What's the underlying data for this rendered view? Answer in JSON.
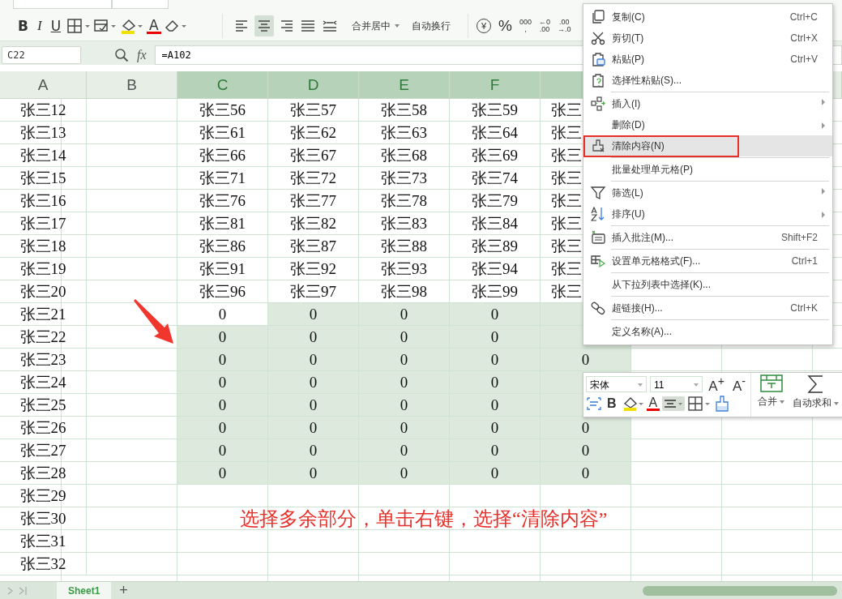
{
  "ribbon": {
    "font_buttons": [
      {
        "kind": "bold",
        "label": "B"
      },
      {
        "kind": "italic",
        "label": "I"
      },
      {
        "kind": "underline",
        "label": "U"
      },
      {
        "kind": "border"
      },
      {
        "kind": "cell-style"
      },
      {
        "kind": "fill"
      },
      {
        "kind": "font-color",
        "label": "A"
      },
      {
        "kind": "eraser"
      }
    ],
    "align_buttons": [
      {
        "kind": "left",
        "selected": false
      },
      {
        "kind": "center",
        "selected": true
      },
      {
        "kind": "right",
        "selected": false
      },
      {
        "kind": "justify",
        "selected": false
      },
      {
        "kind": "distribute",
        "selected": false
      }
    ],
    "merge_label": "合并居中",
    "wrap_label": "自动换行",
    "number_buttons": [
      {
        "kind": "currency",
        "lines": [
          "¥"
        ]
      },
      {
        "kind": "percent",
        "lines": [
          "%"
        ]
      },
      {
        "kind": "thousands",
        "lines": [
          "000",
          ","
        ]
      },
      {
        "kind": "increase-decimal",
        "lines": [
          "←0",
          ".00"
        ]
      },
      {
        "kind": "decrease-decimal",
        "lines": [
          ".00",
          "→.0"
        ]
      }
    ]
  },
  "formula_bar": {
    "name_box": "C22",
    "fx": "fx",
    "formula": "=A102"
  },
  "columns": [
    {
      "label": "A",
      "selected": false
    },
    {
      "label": "B",
      "selected": false
    },
    {
      "label": "C",
      "selected": true
    },
    {
      "label": "D",
      "selected": true
    },
    {
      "label": "E",
      "selected": true
    },
    {
      "label": "F",
      "selected": true
    },
    {
      "selected": true
    }
  ],
  "rows": [
    {
      "label": "张三12",
      "cells": [
        {
          "text": "张三56",
          "selected": false
        },
        {
          "text": "张三57",
          "selected": false
        },
        {
          "text": "张三58",
          "selected": false
        },
        {
          "text": "张三59",
          "selected": false
        },
        {
          "text": "张三",
          "selected": false
        }
      ]
    },
    {
      "label": "张三13",
      "cells": [
        {
          "text": "张三61",
          "selected": false
        },
        {
          "text": "张三62",
          "selected": false
        },
        {
          "text": "张三63",
          "selected": false
        },
        {
          "text": "张三64",
          "selected": false
        },
        {
          "text": "张三",
          "selected": false
        }
      ]
    },
    {
      "label": "张三14",
      "cells": [
        {
          "text": "张三66",
          "selected": false
        },
        {
          "text": "张三67",
          "selected": false
        },
        {
          "text": "张三68",
          "selected": false
        },
        {
          "text": "张三69",
          "selected": false
        },
        {
          "text": "张三",
          "selected": false
        }
      ]
    },
    {
      "label": "张三15",
      "cells": [
        {
          "text": "张三71",
          "selected": false
        },
        {
          "text": "张三72",
          "selected": false
        },
        {
          "text": "张三73",
          "selected": false
        },
        {
          "text": "张三74",
          "selected": false
        },
        {
          "text": "张三",
          "selected": false
        }
      ]
    },
    {
      "label": "张三16",
      "cells": [
        {
          "text": "张三76",
          "selected": false
        },
        {
          "text": "张三77",
          "selected": false
        },
        {
          "text": "张三78",
          "selected": false
        },
        {
          "text": "张三79",
          "selected": false
        },
        {
          "text": "张三",
          "selected": false
        }
      ]
    },
    {
      "label": "张三17",
      "cells": [
        {
          "text": "张三81",
          "selected": false
        },
        {
          "text": "张三82",
          "selected": false
        },
        {
          "text": "张三83",
          "selected": false
        },
        {
          "text": "张三84",
          "selected": false
        },
        {
          "text": "张三",
          "selected": false
        }
      ]
    },
    {
      "label": "张三18",
      "cells": [
        {
          "text": "张三86",
          "selected": false
        },
        {
          "text": "张三87",
          "selected": false
        },
        {
          "text": "张三88",
          "selected": false
        },
        {
          "text": "张三89",
          "selected": false
        },
        {
          "text": "张三",
          "selected": false
        }
      ]
    },
    {
      "label": "张三19",
      "cells": [
        {
          "text": "张三91",
          "selected": false
        },
        {
          "text": "张三92",
          "selected": false
        },
        {
          "text": "张三93",
          "selected": false
        },
        {
          "text": "张三94",
          "selected": false
        },
        {
          "text": "张三",
          "selected": false
        }
      ]
    },
    {
      "label": "张三20",
      "cells": [
        {
          "text": "张三96",
          "selected": false
        },
        {
          "text": "张三97",
          "selected": false
        },
        {
          "text": "张三98",
          "selected": false
        },
        {
          "text": "张三99",
          "selected": false
        },
        {
          "text": "张三",
          "selected": false
        }
      ]
    },
    {
      "label": "张三21",
      "cells": [
        {
          "text": "0",
          "selected": false
        },
        {
          "text": "0",
          "selected": true
        },
        {
          "text": "0",
          "selected": true
        },
        {
          "text": "0",
          "selected": true
        },
        {
          "selected": true
        }
      ]
    },
    {
      "label": "张三22",
      "cells": [
        {
          "text": "0",
          "selected": true
        },
        {
          "text": "0",
          "selected": true
        },
        {
          "text": "0",
          "selected": true
        },
        {
          "text": "0",
          "selected": true
        },
        {
          "selected": true
        }
      ]
    },
    {
      "label": "张三23",
      "cells": [
        {
          "text": "0",
          "selected": true
        },
        {
          "text": "0",
          "selected": true
        },
        {
          "text": "0",
          "selected": true
        },
        {
          "text": "0",
          "selected": true
        },
        {
          "text": "0",
          "selected": true
        }
      ]
    },
    {
      "label": "张三24",
      "cells": [
        {
          "text": "0",
          "selected": true
        },
        {
          "text": "0",
          "selected": true
        },
        {
          "text": "0",
          "selected": true
        },
        {
          "text": "0",
          "selected": true
        },
        {
          "selected": true
        }
      ]
    },
    {
      "label": "张三25",
      "cells": [
        {
          "text": "0",
          "selected": true
        },
        {
          "text": "0",
          "selected": true
        },
        {
          "text": "0",
          "selected": true
        },
        {
          "text": "0",
          "selected": true
        },
        {
          "selected": true
        }
      ]
    },
    {
      "label": "张三26",
      "cells": [
        {
          "text": "0",
          "selected": true
        },
        {
          "text": "0",
          "selected": true
        },
        {
          "text": "0",
          "selected": true
        },
        {
          "text": "0",
          "selected": true
        },
        {
          "text": "0",
          "selected": true
        }
      ]
    },
    {
      "label": "张三27",
      "cells": [
        {
          "text": "0",
          "selected": true
        },
        {
          "text": "0",
          "selected": true
        },
        {
          "text": "0",
          "selected": true
        },
        {
          "text": "0",
          "selected": true
        },
        {
          "text": "0",
          "selected": true
        }
      ]
    },
    {
      "label": "张三28",
      "cells": [
        {
          "text": "0",
          "selected": true
        },
        {
          "text": "0",
          "selected": true
        },
        {
          "text": "0",
          "selected": true
        },
        {
          "text": "0",
          "selected": true
        },
        {
          "text": "0",
          "selected": true
        }
      ]
    },
    {
      "label": "张三29",
      "cells": []
    },
    {
      "label": "张三30",
      "cells": []
    },
    {
      "label": "张三31",
      "cells": []
    },
    {
      "label": "张三32",
      "cells": []
    }
  ],
  "context_menu": [
    {
      "kind": "copy",
      "label": "复制(C)",
      "shortcut": "Ctrl+C",
      "submenu": false,
      "selected": false,
      "separator_before": false
    },
    {
      "kind": "cut",
      "label": "剪切(T)",
      "shortcut": "Ctrl+X",
      "submenu": false,
      "selected": false,
      "separator_before": false
    },
    {
      "kind": "paste",
      "label": "粘贴(P)",
      "shortcut": "Ctrl+V",
      "submenu": false,
      "selected": false,
      "separator_before": false
    },
    {
      "kind": "paste-special",
      "label": "选择性粘贴(S)...",
      "submenu": false,
      "selected": false,
      "separator_before": false
    },
    {
      "kind": "insert",
      "label": "插入(I)",
      "submenu": true,
      "selected": false,
      "separator_before": true
    },
    {
      "kind": "none",
      "label": "删除(D)",
      "submenu": true,
      "selected": false,
      "separator_before": false
    },
    {
      "kind": "clear",
      "label": "清除内容(N)",
      "submenu": false,
      "selected": true,
      "separator_before": false
    },
    {
      "kind": "none",
      "label": "批量处理单元格(P)",
      "submenu": false,
      "selected": false,
      "separator_before": true
    },
    {
      "kind": "filter",
      "label": "筛选(L)",
      "submenu": true,
      "selected": false,
      "separator_before": true
    },
    {
      "kind": "sort",
      "label": "排序(U)",
      "submenu": true,
      "selected": false,
      "separator_before": false
    },
    {
      "kind": "comment",
      "label": "插入批注(M)...",
      "shortcut": "Shift+F2",
      "submenu": false,
      "selected": false,
      "separator_before": true
    },
    {
      "kind": "format",
      "label": "设置单元格格式(F)...",
      "shortcut": "Ctrl+1",
      "submenu": false,
      "selected": false,
      "separator_before": true
    },
    {
      "kind": "none",
      "label": "从下拉列表中选择(K)...",
      "submenu": false,
      "selected": false,
      "separator_before": true
    },
    {
      "kind": "link",
      "label": "超链接(H)...",
      "shortcut": "Ctrl+K",
      "submenu": false,
      "selected": false,
      "separator_before": true
    },
    {
      "kind": "none",
      "label": "定义名称(A)...",
      "submenu": false,
      "selected": false,
      "separator_before": true
    }
  ],
  "mini_toolbar": {
    "font": "宋体",
    "size": "11",
    "grow": "A$^{+}$",
    "shrink": "A$^{-}$",
    "bold": "B",
    "font_color": "A",
    "center_selected": true,
    "merge_label": "合并",
    "sum_label": "自动求和"
  },
  "annotation": "选择多余部分，单击右键，选择“清除内容”",
  "sheet_tabs": [
    {
      "label": "Sheet1",
      "selected": true
    }
  ],
  "add_sheet": "+"
}
